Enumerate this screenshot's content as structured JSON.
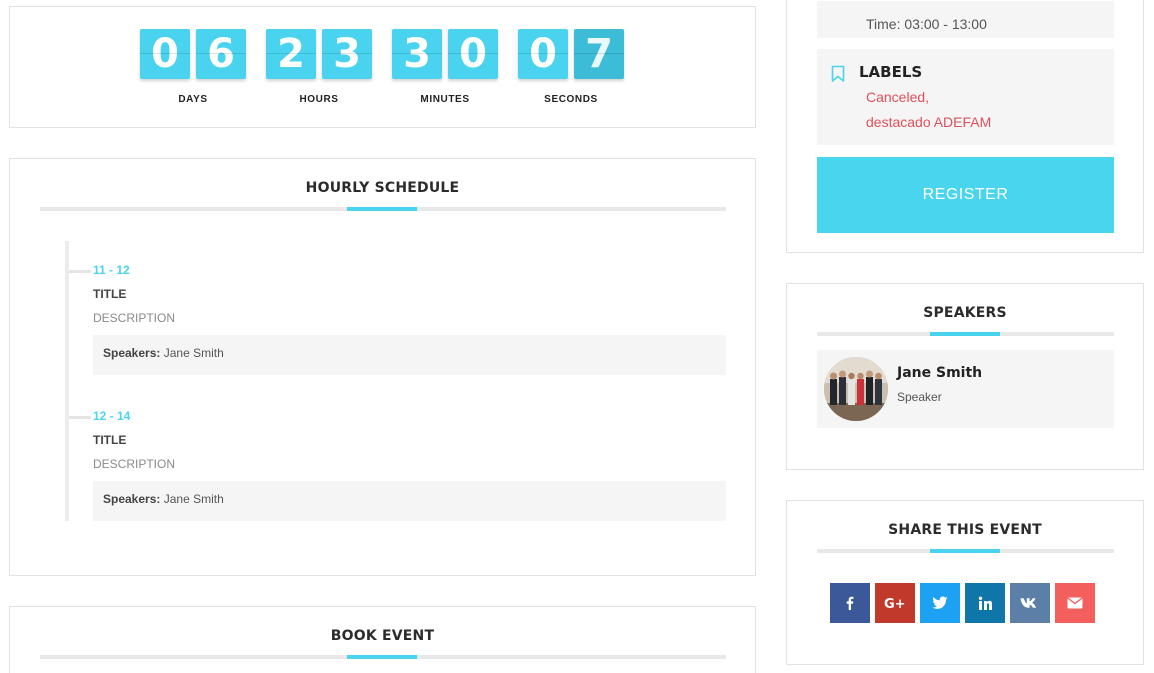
{
  "countdown": {
    "groups": [
      {
        "digits": [
          "0",
          "6"
        ],
        "label": "DAYS"
      },
      {
        "digits": [
          "2",
          "3"
        ],
        "label": "HOURS"
      },
      {
        "digits": [
          "3",
          "0"
        ],
        "label": "MINUTES"
      },
      {
        "digits": [
          "0",
          "7"
        ],
        "label": "SECONDS"
      }
    ]
  },
  "schedule": {
    "title": "HOURLY SCHEDULE",
    "items": [
      {
        "time": "11 - 12",
        "title": "TITLE",
        "description": "DESCRIPTION",
        "speakers_label": "Speakers:",
        "speakers": "Jane Smith"
      },
      {
        "time": "12 - 14",
        "title": "TITLE",
        "description": "DESCRIPTION",
        "speakers_label": "Speakers:",
        "speakers": "Jane Smith"
      }
    ]
  },
  "book": {
    "title": "BOOK EVENT"
  },
  "info": {
    "time": "Time: 03:00 - 13:00",
    "labels_heading": "LABELS",
    "labels": [
      "Canceled,",
      "destacado ADEFAM"
    ],
    "register_label": "REGISTER"
  },
  "speakers": {
    "title": "SPEAKERS",
    "list": [
      {
        "name": "Jane Smith",
        "role": "Speaker"
      }
    ]
  },
  "share": {
    "title": "SHARE THIS EVENT",
    "buttons": [
      {
        "icon": "facebook-icon",
        "color": "#3b5998"
      },
      {
        "icon": "google-plus-icon",
        "color": "#c1392b"
      },
      {
        "icon": "twitter-icon",
        "color": "#1da1f2"
      },
      {
        "icon": "linkedin-icon",
        "color": "#0e76a8"
      },
      {
        "icon": "vk-icon",
        "color": "#5b7fa6"
      },
      {
        "icon": "email-icon",
        "color": "#f25f5c"
      }
    ]
  },
  "colors": {
    "accent": "#4ad3ee",
    "label_red": "#e0505a"
  }
}
